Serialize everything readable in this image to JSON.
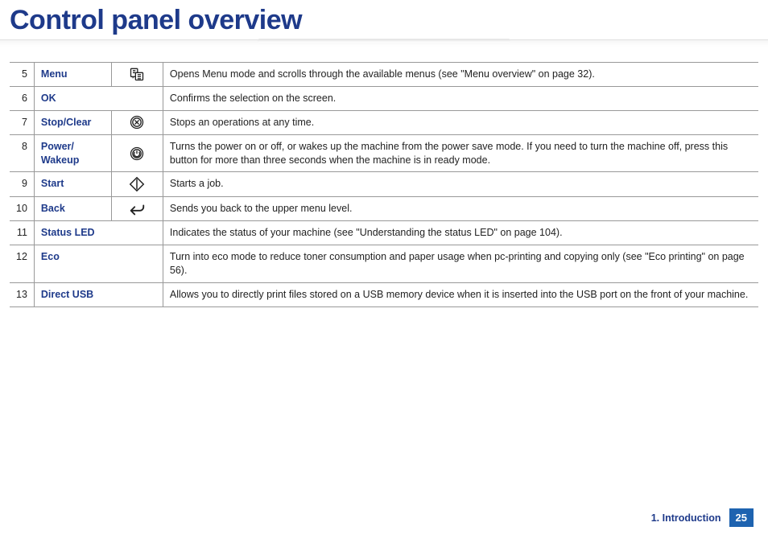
{
  "title": "Control panel overview",
  "rows": [
    {
      "num": "5",
      "label": "Menu",
      "icon": "menu",
      "desc": "Opens Menu mode and scrolls through the available menus (see \"Menu overview\" on page 32)."
    },
    {
      "num": "6",
      "label": "OK",
      "icon": null,
      "desc": "Confirms the selection on the screen."
    },
    {
      "num": "7",
      "label": "Stop/Clear",
      "icon": "stop",
      "desc": "Stops an operations at any time."
    },
    {
      "num": "8",
      "label": "Power/ Wakeup",
      "icon": "power",
      "desc": "Turns the power on or off, or wakes up the machine from the power save mode. If you need to turn the machine off, press this button for more than three seconds when the machine is in ready mode."
    },
    {
      "num": "9",
      "label": "Start",
      "icon": "start",
      "desc": "Starts a job."
    },
    {
      "num": "10",
      "label": "Back",
      "icon": "back",
      "desc": "Sends you back to the upper menu level."
    },
    {
      "num": "11",
      "label": "Status LED",
      "icon": null,
      "desc": "Indicates the status of your machine (see \"Understanding the status LED\" on page 104)."
    },
    {
      "num": "12",
      "label": "Eco",
      "icon": null,
      "desc": "Turn into eco mode to reduce toner consumption and paper usage when pc-printing and copying only (see \"Eco printing\" on page 56)."
    },
    {
      "num": "13",
      "label": "Direct USB",
      "icon": null,
      "desc": "Allows you to directly print files stored on a USB memory device when it is inserted into the USB port on the front of your machine."
    }
  ],
  "footer": {
    "chapter": "1. Introduction",
    "page": "25"
  }
}
